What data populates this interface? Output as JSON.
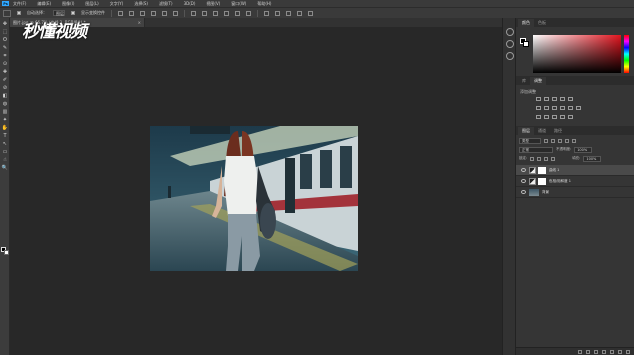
{
  "app": {
    "logo": "Ps"
  },
  "menu": [
    "文件(F)",
    "编辑(E)",
    "图像(I)",
    "图层(L)",
    "文字(Y)",
    "选择(S)",
    "滤镜(T)",
    "3D(D)",
    "视图(V)",
    "窗口(W)",
    "帮助(H)"
  ],
  "options": {
    "auto_select_label": "自动选择：",
    "auto_select_target": "图层",
    "transform_label": "显示变换控件"
  },
  "document": {
    "tab_label": "图片.jpg @ 66.7% (曲线 1, RGB/8#) *",
    "close": "×"
  },
  "watermark": {
    "text": "秒懂视频"
  },
  "tools": [
    "✥",
    "⬚",
    "ʘ",
    "✎",
    "⌗",
    "⊙",
    "✚",
    "✐",
    "⊘",
    "◧",
    "◍",
    "▥",
    "✦",
    "✋",
    "T",
    "↖",
    "▭",
    "☝",
    "🔍"
  ],
  "panels": {
    "color_tabs": [
      "颜色",
      "色板"
    ],
    "adjust_tabs": [
      "库",
      "调整"
    ],
    "adjust_title": "添加调整",
    "layers_tabs": [
      "图层",
      "通道",
      "路径"
    ],
    "filter_kind": "类型",
    "blend_mode": "正常",
    "opacity_label": "不透明度:",
    "opacity_value": "100%",
    "lock_label": "锁定:",
    "fill_label": "填充:",
    "fill_value": "100%",
    "layers": [
      {
        "name": "曲线 1",
        "type": "adjustment",
        "selected": true
      },
      {
        "name": "色相/饱和度 1",
        "type": "adjustment",
        "selected": false
      },
      {
        "name": "背景",
        "type": "image",
        "selected": false
      }
    ]
  },
  "colors": {
    "foreground": "#000000",
    "background": "#ffffff",
    "picker_hue": "#e0141e"
  },
  "icons": {
    "move_tool": "move-icon",
    "visibility": "eye-icon",
    "dock": [
      "history-icon",
      "properties-icon",
      "info-icon"
    ]
  }
}
